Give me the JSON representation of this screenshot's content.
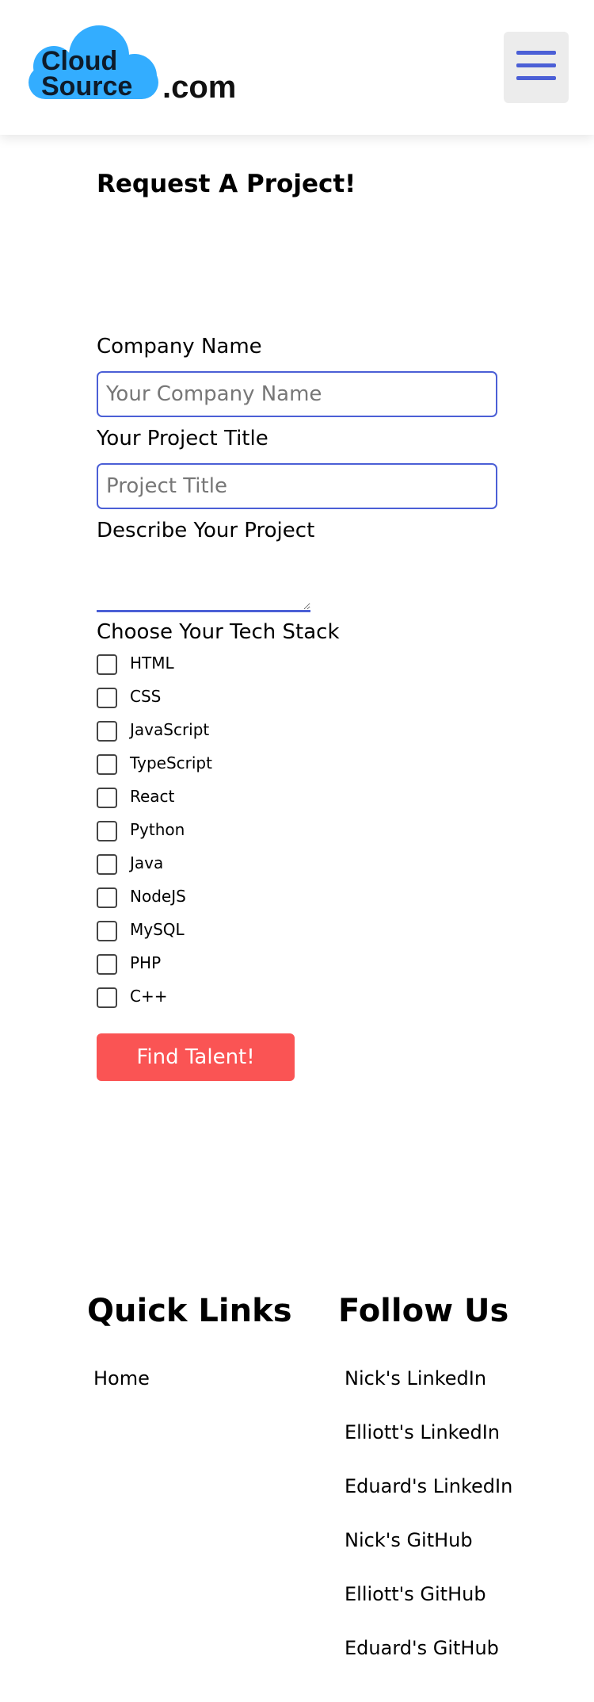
{
  "header": {
    "logo": {
      "word1": "Cloud",
      "word2": "Source",
      "suffix": ".com",
      "cloud_color": "#33adff"
    },
    "menu_icon": "hamburger-menu-icon"
  },
  "form": {
    "title": "Request A Project!",
    "company_label": "Company Name",
    "company_placeholder": "Your Company Name",
    "project_label": "Your Project Title",
    "project_placeholder": "Project Title",
    "describe_label": "Describe Your Project",
    "stack_label": "Choose Your Tech Stack",
    "tech_stack": [
      "HTML",
      "CSS",
      "JavaScript",
      "TypeScript",
      "React",
      "Python",
      "Java",
      "NodeJS",
      "MySQL",
      "PHP",
      "C++"
    ],
    "submit_label": "Find Talent!",
    "accent_color": "#4b5fd6",
    "button_color": "#fa5454"
  },
  "footer": {
    "quick_links_title": "Quick Links",
    "quick_links": [
      "Home"
    ],
    "follow_title": "Follow Us",
    "follow_links": [
      "Nick's LinkedIn",
      "Elliott's LinkedIn",
      "Eduard's LinkedIn",
      "Nick's GitHub",
      "Elliott's GitHub",
      "Eduard's GitHub"
    ]
  }
}
